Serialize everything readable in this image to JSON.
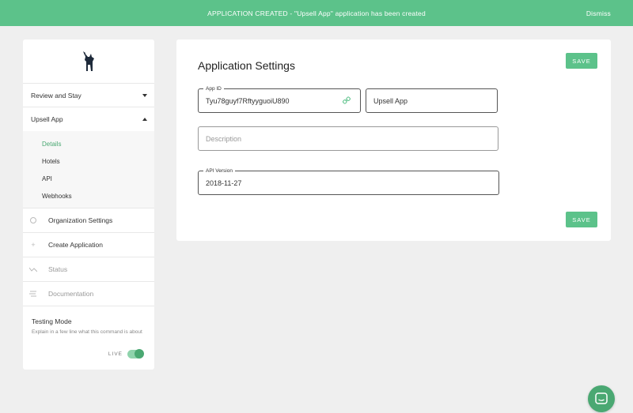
{
  "banner": {
    "message": "APPLICATION CREATED - \"Upsell App\" application has been created",
    "dismiss_label": "Dismiss"
  },
  "sidebar": {
    "apps": [
      {
        "label": "Review and Stay",
        "expanded": false
      },
      {
        "label": "Upsell App",
        "expanded": true
      }
    ],
    "sub_items": [
      "Details",
      "Hotels",
      "API",
      "Webhooks"
    ],
    "active_sub_item": "Details",
    "nav_items": [
      {
        "label": "Organization Settings",
        "icon": "circle-icon"
      },
      {
        "label": "Create Application",
        "icon": "plus-icon"
      },
      {
        "label": "Status",
        "icon": "trend-icon"
      },
      {
        "label": "Documentation",
        "icon": "lines-icon"
      }
    ],
    "testing": {
      "title": "Testing Mode",
      "description": "Explain in a few line what this command is about",
      "live_label": "LIVE",
      "live_on": true
    }
  },
  "main": {
    "title": "Application Settings",
    "save_label": "SAVE",
    "app_id": {
      "label": "App ID",
      "value": "Tyu78guyf7RftyyguoiU890"
    },
    "app_name": {
      "value": "Upsell App"
    },
    "description": {
      "placeholder": "Description"
    },
    "api_version": {
      "label": "API Version",
      "value": "2018-11-27"
    }
  },
  "colors": {
    "accent": "#5cc28a",
    "accent_dark": "#4aa872",
    "background": "#efefef"
  }
}
